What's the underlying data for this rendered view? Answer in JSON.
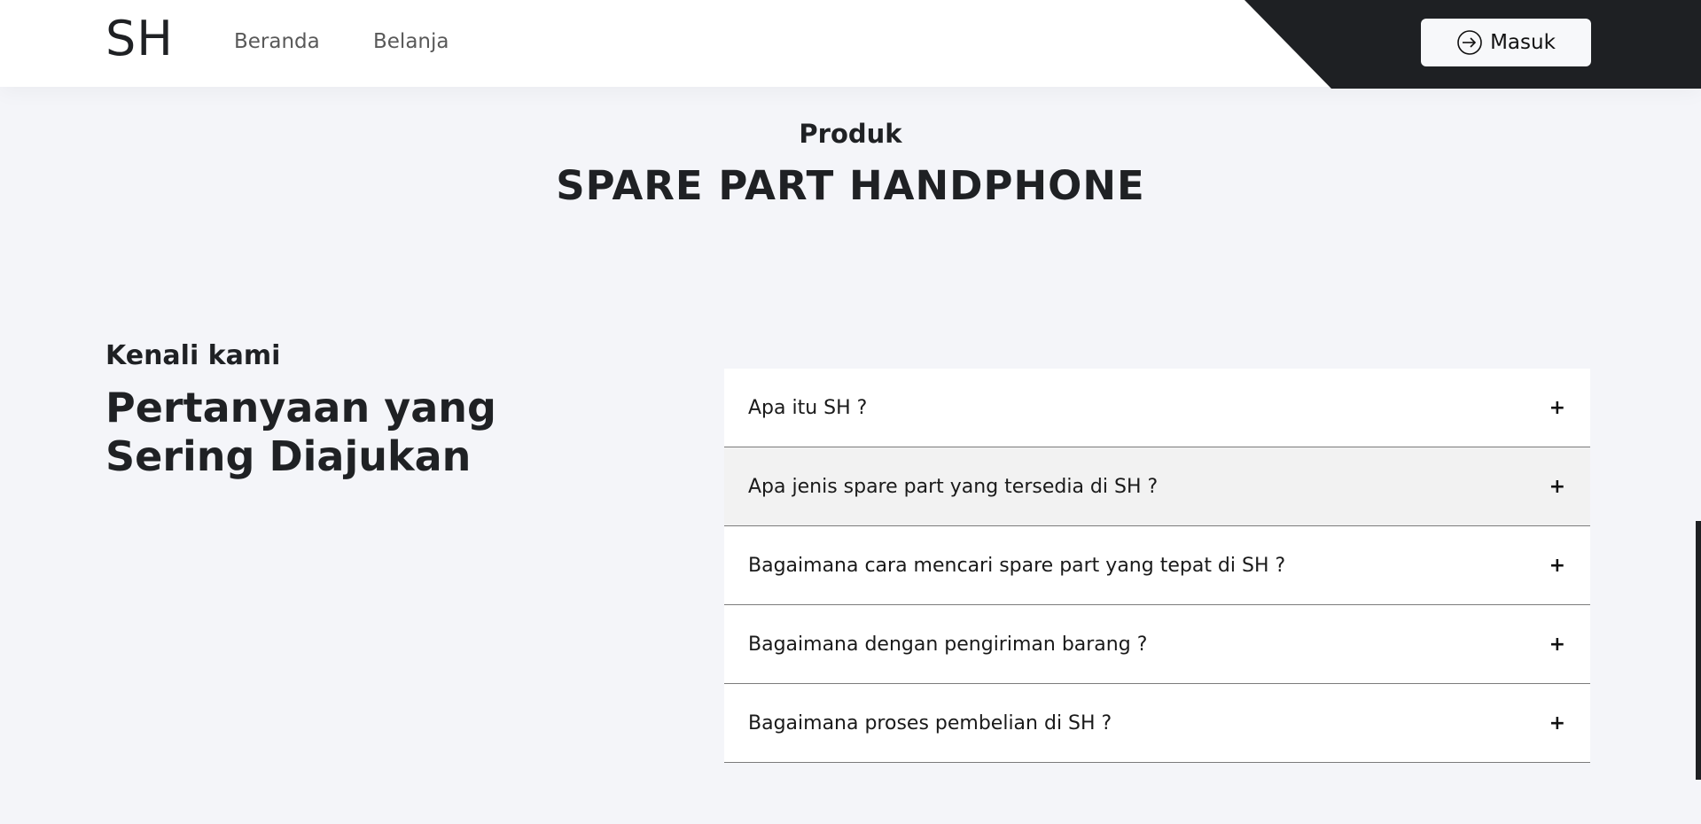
{
  "header": {
    "logo": "SH",
    "nav": [
      {
        "label": "Beranda"
      },
      {
        "label": "Belanja"
      }
    ],
    "login_label": "Masuk",
    "login_icon": "login-arrow-icon"
  },
  "product": {
    "eyebrow": "Produk",
    "title": "SPARE PART HANDPHONE"
  },
  "faq": {
    "eyebrow": "Kenali kami",
    "title": "Pertanyaan yang Sering Diajukan",
    "items": [
      {
        "question": "Apa itu SH ?",
        "icon": "plus-icon"
      },
      {
        "question": "Apa jenis spare part yang tersedia di SH ?",
        "icon": "plus-icon"
      },
      {
        "question": "Bagaimana cara mencari spare part yang tepat di SH ?",
        "icon": "plus-icon"
      },
      {
        "question": "Bagaimana dengan pengiriman barang ?",
        "icon": "plus-icon"
      },
      {
        "question": "Bagaimana proses pembelian di SH ?",
        "icon": "plus-icon"
      }
    ],
    "expand_symbol": "+"
  },
  "colors": {
    "background": "#f4f5f9",
    "header_dark": "#1e2023",
    "text": "#1f2124",
    "hover_row": "#f2f2f2"
  }
}
